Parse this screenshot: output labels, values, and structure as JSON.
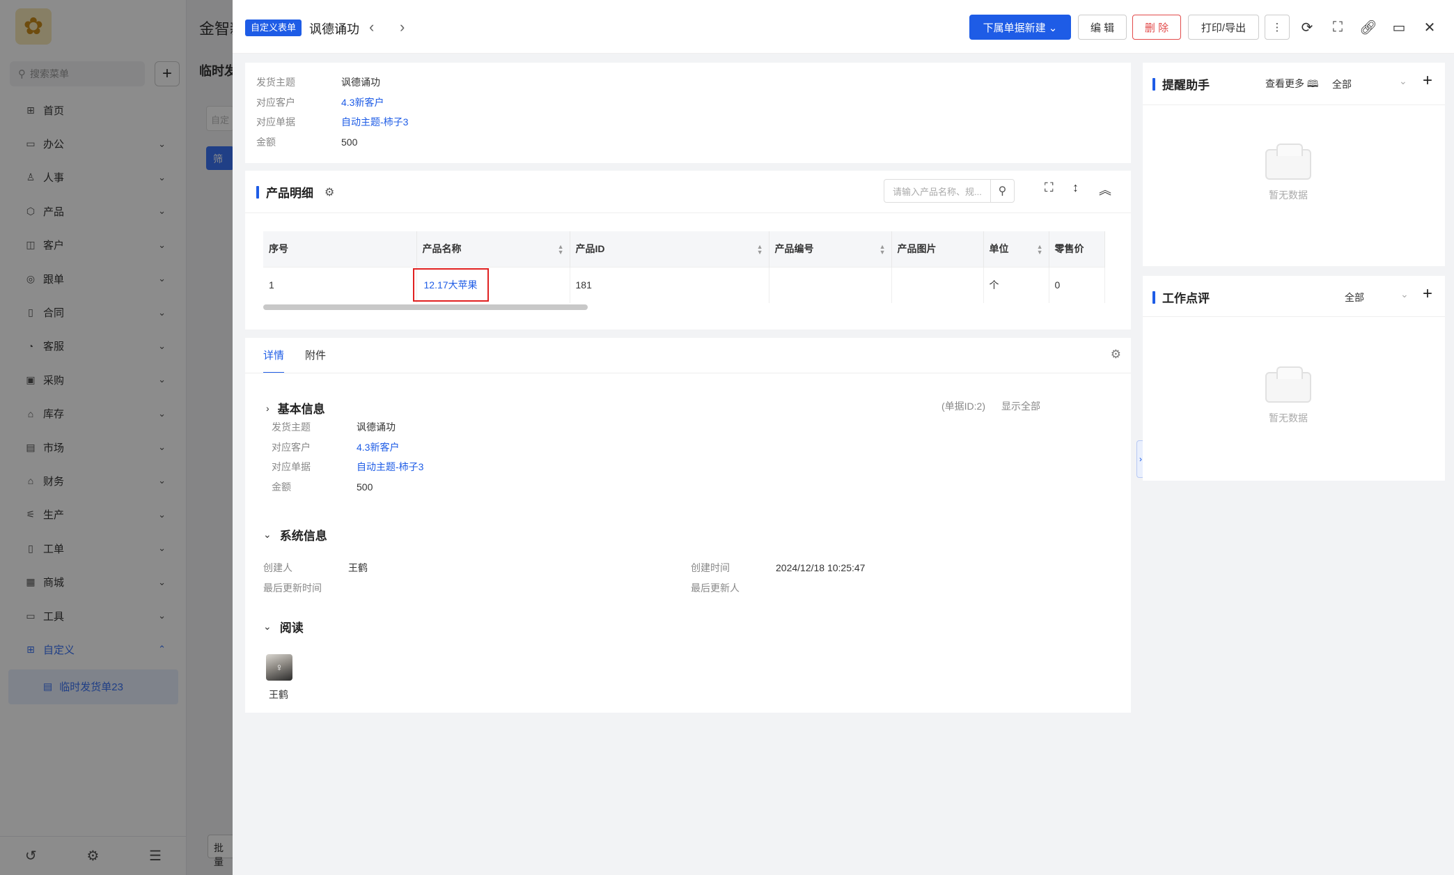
{
  "bg": {
    "app_title": "金智新",
    "search_placeholder": "搜索菜单",
    "add_label": "+",
    "menu": [
      {
        "icon": "⊞",
        "label": "首页",
        "arrow": ""
      },
      {
        "icon": "▭",
        "label": "办公",
        "arrow": "⌄"
      },
      {
        "icon": "♙",
        "label": "人事",
        "arrow": "⌄"
      },
      {
        "icon": "⬡",
        "label": "产品",
        "arrow": "⌄"
      },
      {
        "icon": "◫",
        "label": "客户",
        "arrow": "⌄"
      },
      {
        "icon": "◎",
        "label": "跟单",
        "arrow": "⌄"
      },
      {
        "icon": "▯",
        "label": "合同",
        "arrow": "⌄"
      },
      {
        "icon": "◔",
        "label": "客服",
        "arrow": "⌄"
      },
      {
        "icon": "▣",
        "label": "采购",
        "arrow": "⌄"
      },
      {
        "icon": "⌂",
        "label": "库存",
        "arrow": "⌄"
      },
      {
        "icon": "▤",
        "label": "市场",
        "arrow": "⌄"
      },
      {
        "icon": "⌂",
        "label": "财务",
        "arrow": "⌄"
      },
      {
        "icon": "⚟",
        "label": "生产",
        "arrow": "⌄"
      },
      {
        "icon": "▯",
        "label": "工单",
        "arrow": "⌄"
      },
      {
        "icon": "▦",
        "label": "商城",
        "arrow": "⌄"
      },
      {
        "icon": "▭",
        "label": "工具",
        "arrow": "⌄"
      },
      {
        "icon": "⊞",
        "label": "自定义",
        "arrow": "⌃"
      }
    ],
    "submenu_item": "临时发货单23",
    "main_title": "金智新",
    "tab": "临时发",
    "input_stub": "自定",
    "filter_btn": "筛",
    "batch_btn": "批量"
  },
  "drawer": {
    "form_tag": "自定义表单",
    "title": "讽德诵功",
    "buttons": {
      "new_sub": "下属单据新建 ⌄",
      "edit": "编 辑",
      "delete": "删 除",
      "print": "打印/导出",
      "more": "⋮"
    }
  },
  "summary": [
    {
      "label": "发货主题",
      "value": "讽德诵功",
      "link": false
    },
    {
      "label": "对应客户",
      "value": "4.3新客户",
      "link": true
    },
    {
      "label": "对应单据",
      "value": "自动主题-柿子3",
      "link": true
    },
    {
      "label": "金额",
      "value": "500",
      "link": false
    }
  ],
  "product_detail": {
    "title": "产品明细",
    "search_placeholder": "请输入产品名称、规...",
    "columns": [
      "序号",
      "产品名称",
      "产品ID",
      "产品编号",
      "产品图片",
      "单位",
      "零售价"
    ],
    "rows": [
      {
        "seq": "1",
        "name": "12.17大苹果",
        "id": "181",
        "code": "",
        "image": "",
        "unit": "个",
        "price": "0"
      }
    ]
  },
  "detail": {
    "tabs": [
      "详情",
      "附件"
    ],
    "basic_info": {
      "title": "基本信息",
      "doc_id": "(单据ID:2)",
      "show_all": "显示全部",
      "fields": [
        {
          "label": "发货主题",
          "value": "讽德诵功",
          "link": false
        },
        {
          "label": "对应客户",
          "value": "4.3新客户",
          "link": true
        },
        {
          "label": "对应单据",
          "value": "自动主题-柿子3",
          "link": true
        },
        {
          "label": "金额",
          "value": "500",
          "link": false
        }
      ]
    },
    "system_info": {
      "title": "系统信息",
      "creator_label": "创建人",
      "creator": "王鹤",
      "created_label": "创建时间",
      "created": "2024/12/18 10:25:47",
      "updated_label": "最后更新时间",
      "updated": "",
      "updater_label": "最后更新人",
      "updater": ""
    },
    "read": {
      "title": "阅读",
      "reader": "王鹤"
    }
  },
  "reminder": {
    "title": "提醒助手",
    "more": "查看更多",
    "filter": "全部",
    "empty": "暂无数据"
  },
  "review": {
    "title": "工作点评",
    "filter": "全部",
    "empty": "暂无数据"
  },
  "colors": {
    "primary": "#1e5ce6",
    "danger": "#e24a4a",
    "highlight_border": "#e02020"
  }
}
